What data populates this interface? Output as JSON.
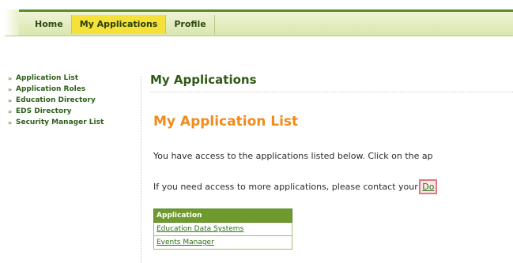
{
  "nav": {
    "tabs": [
      {
        "label": "Home"
      },
      {
        "label": "My Applications"
      },
      {
        "label": "Profile"
      }
    ],
    "active": "My Applications"
  },
  "sidebar": {
    "items": [
      {
        "label": "Application List"
      },
      {
        "label": "Application Roles"
      },
      {
        "label": "Education Directory"
      },
      {
        "label": "EDS Directory"
      },
      {
        "label": "Security Manager List"
      }
    ]
  },
  "main": {
    "title": "My Applications",
    "section_title": "My Application List",
    "para1": "You have access to the applications listed below. Click on the ap",
    "para2_prefix": "If you need access to more applications, please contact your ",
    "para2_link": "Do",
    "table": {
      "header": "Application",
      "rows": [
        {
          "name": "Education Data Systems"
        },
        {
          "name": "Events Manager"
        }
      ]
    }
  },
  "colors": {
    "nav_active": "#f5e13a",
    "brand_green": "#2e5a14",
    "section_orange": "#f08b1c",
    "table_header": "#6f9a2d"
  }
}
